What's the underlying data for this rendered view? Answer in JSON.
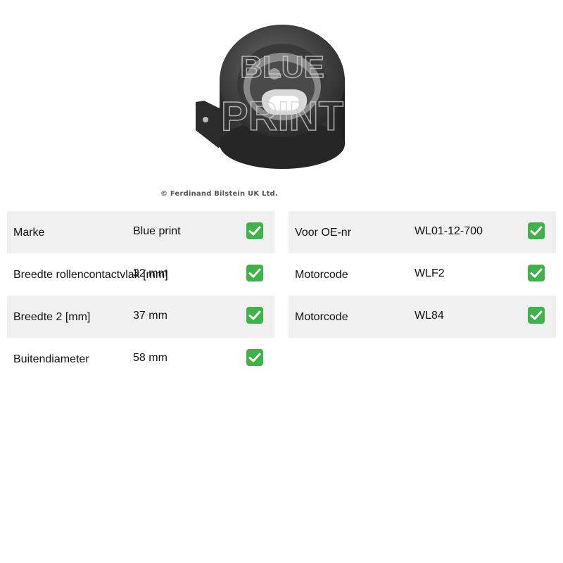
{
  "product": {
    "copyright": "© Ferdinand Bilstein UK Ltd.",
    "watermark": [
      "BLUE",
      "PRINT"
    ]
  },
  "specs_left": [
    {
      "label": "Marke",
      "value": "Blue print",
      "icon": "check-icon"
    },
    {
      "label": "Breedte rollencontactvlak [mm]",
      "value": "32 mm",
      "icon": "check-icon"
    },
    {
      "label": "Breedte 2 [mm]",
      "value": "37 mm",
      "icon": "check-icon"
    },
    {
      "label": "Buitendiameter",
      "value": "58 mm",
      "icon": "check-icon"
    }
  ],
  "specs_right": [
    {
      "label": "Voor OE-nr",
      "value": "WL01-12-700",
      "icon": "check-icon"
    },
    {
      "label": "Motorcode",
      "value": "WLF2",
      "icon": "check-icon"
    },
    {
      "label": "Motorcode",
      "value": "WL84",
      "icon": "check-icon"
    }
  ],
  "colors": {
    "row_shade": "#f0f0f0",
    "check_green": "#3fb24a"
  }
}
